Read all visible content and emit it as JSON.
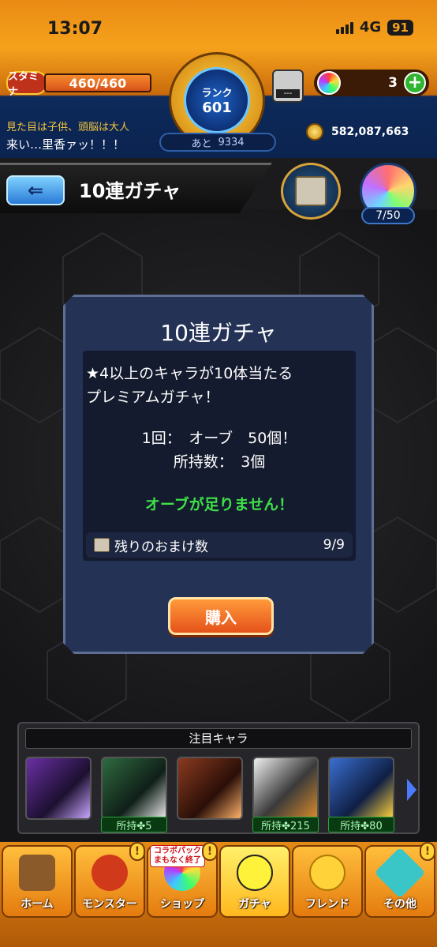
{
  "status_bar": {
    "time": "13:07",
    "network": "4G",
    "battery": "91"
  },
  "header": {
    "stamina_label": "スタミナ",
    "stamina_value": "460/460",
    "rank_label": "ランク",
    "rank_value": "601",
    "next_rank_label": "あと",
    "next_rank_value": "9334",
    "machine_label": "---",
    "orb_count": "3",
    "plus_symbol": "+",
    "subtitle": "見た目は子供、頭脳は大人",
    "player_name": "来い…里香ァッ！！！",
    "gold": "582,087,663",
    "medal_count": "7/50"
  },
  "title_bar": {
    "back_symbol": "⇐",
    "title": "10連ガチャ"
  },
  "dialog": {
    "title": "10連ガチャ",
    "description_line1": "★4以上のキャラが10体当たる",
    "description_line2": "プレミアムガチャ！",
    "cost_line": "1回：　オーブ　50個！",
    "owned_line": "所持数：　3個",
    "warning": "オーブが足りません！",
    "bonus_label": "残りのおまけ数",
    "bonus_value": "9/9",
    "buy_label": "購入"
  },
  "featured": {
    "header": "注目キャラ",
    "characters": [
      {
        "count": ""
      },
      {
        "count": "所持✤5"
      },
      {
        "count": ""
      },
      {
        "count": "所持✤215"
      },
      {
        "count": "所持✤80"
      }
    ]
  },
  "nav": {
    "items": [
      {
        "label": "ホーム"
      },
      {
        "label": "モンスター"
      },
      {
        "label": "ショップ",
        "badge": "コラボパック まもなく終了"
      },
      {
        "label": "ガチャ"
      },
      {
        "label": "フレンド"
      },
      {
        "label": "その他"
      }
    ],
    "alert_symbol": "!"
  },
  "colors": {
    "header_orange": "#f6a21c",
    "dialog_bg": "#243255",
    "warning_green": "#3ee048",
    "buy_orange": "#e5521a"
  }
}
